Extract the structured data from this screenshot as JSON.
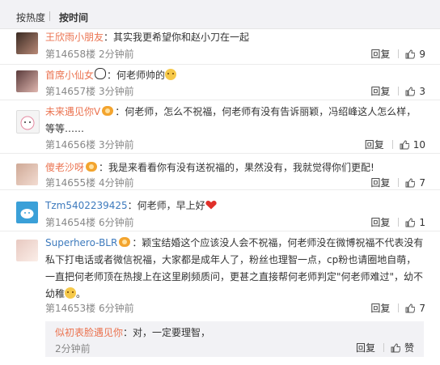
{
  "sort": {
    "by_hot": "按热度",
    "by_time": "按时间"
  },
  "labels": {
    "reply": "回复",
    "like": "赞"
  },
  "comments": [
    {
      "user": "王欣雨小朋友",
      "text": "：其实我更希望你和赵小刀在一起",
      "floor": "第14658楼",
      "time": "2分钟前",
      "likes": "9"
    },
    {
      "user": "首席小仙女",
      "text": "：何老师帅的",
      "floor": "第14657楼",
      "time": "3分钟前",
      "likes": "3"
    },
    {
      "user": "未来遇见你V",
      "text": "：何老师，怎么不祝福，何老师有没有告诉丽颖，冯绍峰这人怎么样，等等……",
      "floor": "第14656楼",
      "time": "3分钟前",
      "likes": "10"
    },
    {
      "user": "傻老沙呀",
      "text": "：我是来看看你有没有送祝福的，果然没有，我就觉得你们更配!",
      "floor": "第14655楼",
      "time": "4分钟前",
      "likes": "7"
    },
    {
      "user": "Tzm5402239425",
      "text": "：何老师，早上好",
      "floor": "第14654楼",
      "time": "6分钟前",
      "likes": "1"
    },
    {
      "user": "Superhero-BLR",
      "text": "：颖宝结婚这个应该没人会不祝福，何老师没在微博祝福不代表没有私下打电话或者微信祝福，大家都是成年人了，粉丝也理智一点，cp粉也请圈地自萌，一直把何老师顶在热搜上在这里刷频质问，更甚之直接帮何老师判定\"何老师难过\"，幼不幼稚",
      "floor": "第14653楼",
      "time": "6分钟前",
      "likes": "7"
    }
  ],
  "subreply": {
    "user": "似初表脸遇见你",
    "text": "：对，一定要理智，",
    "time": "2分钟前"
  }
}
